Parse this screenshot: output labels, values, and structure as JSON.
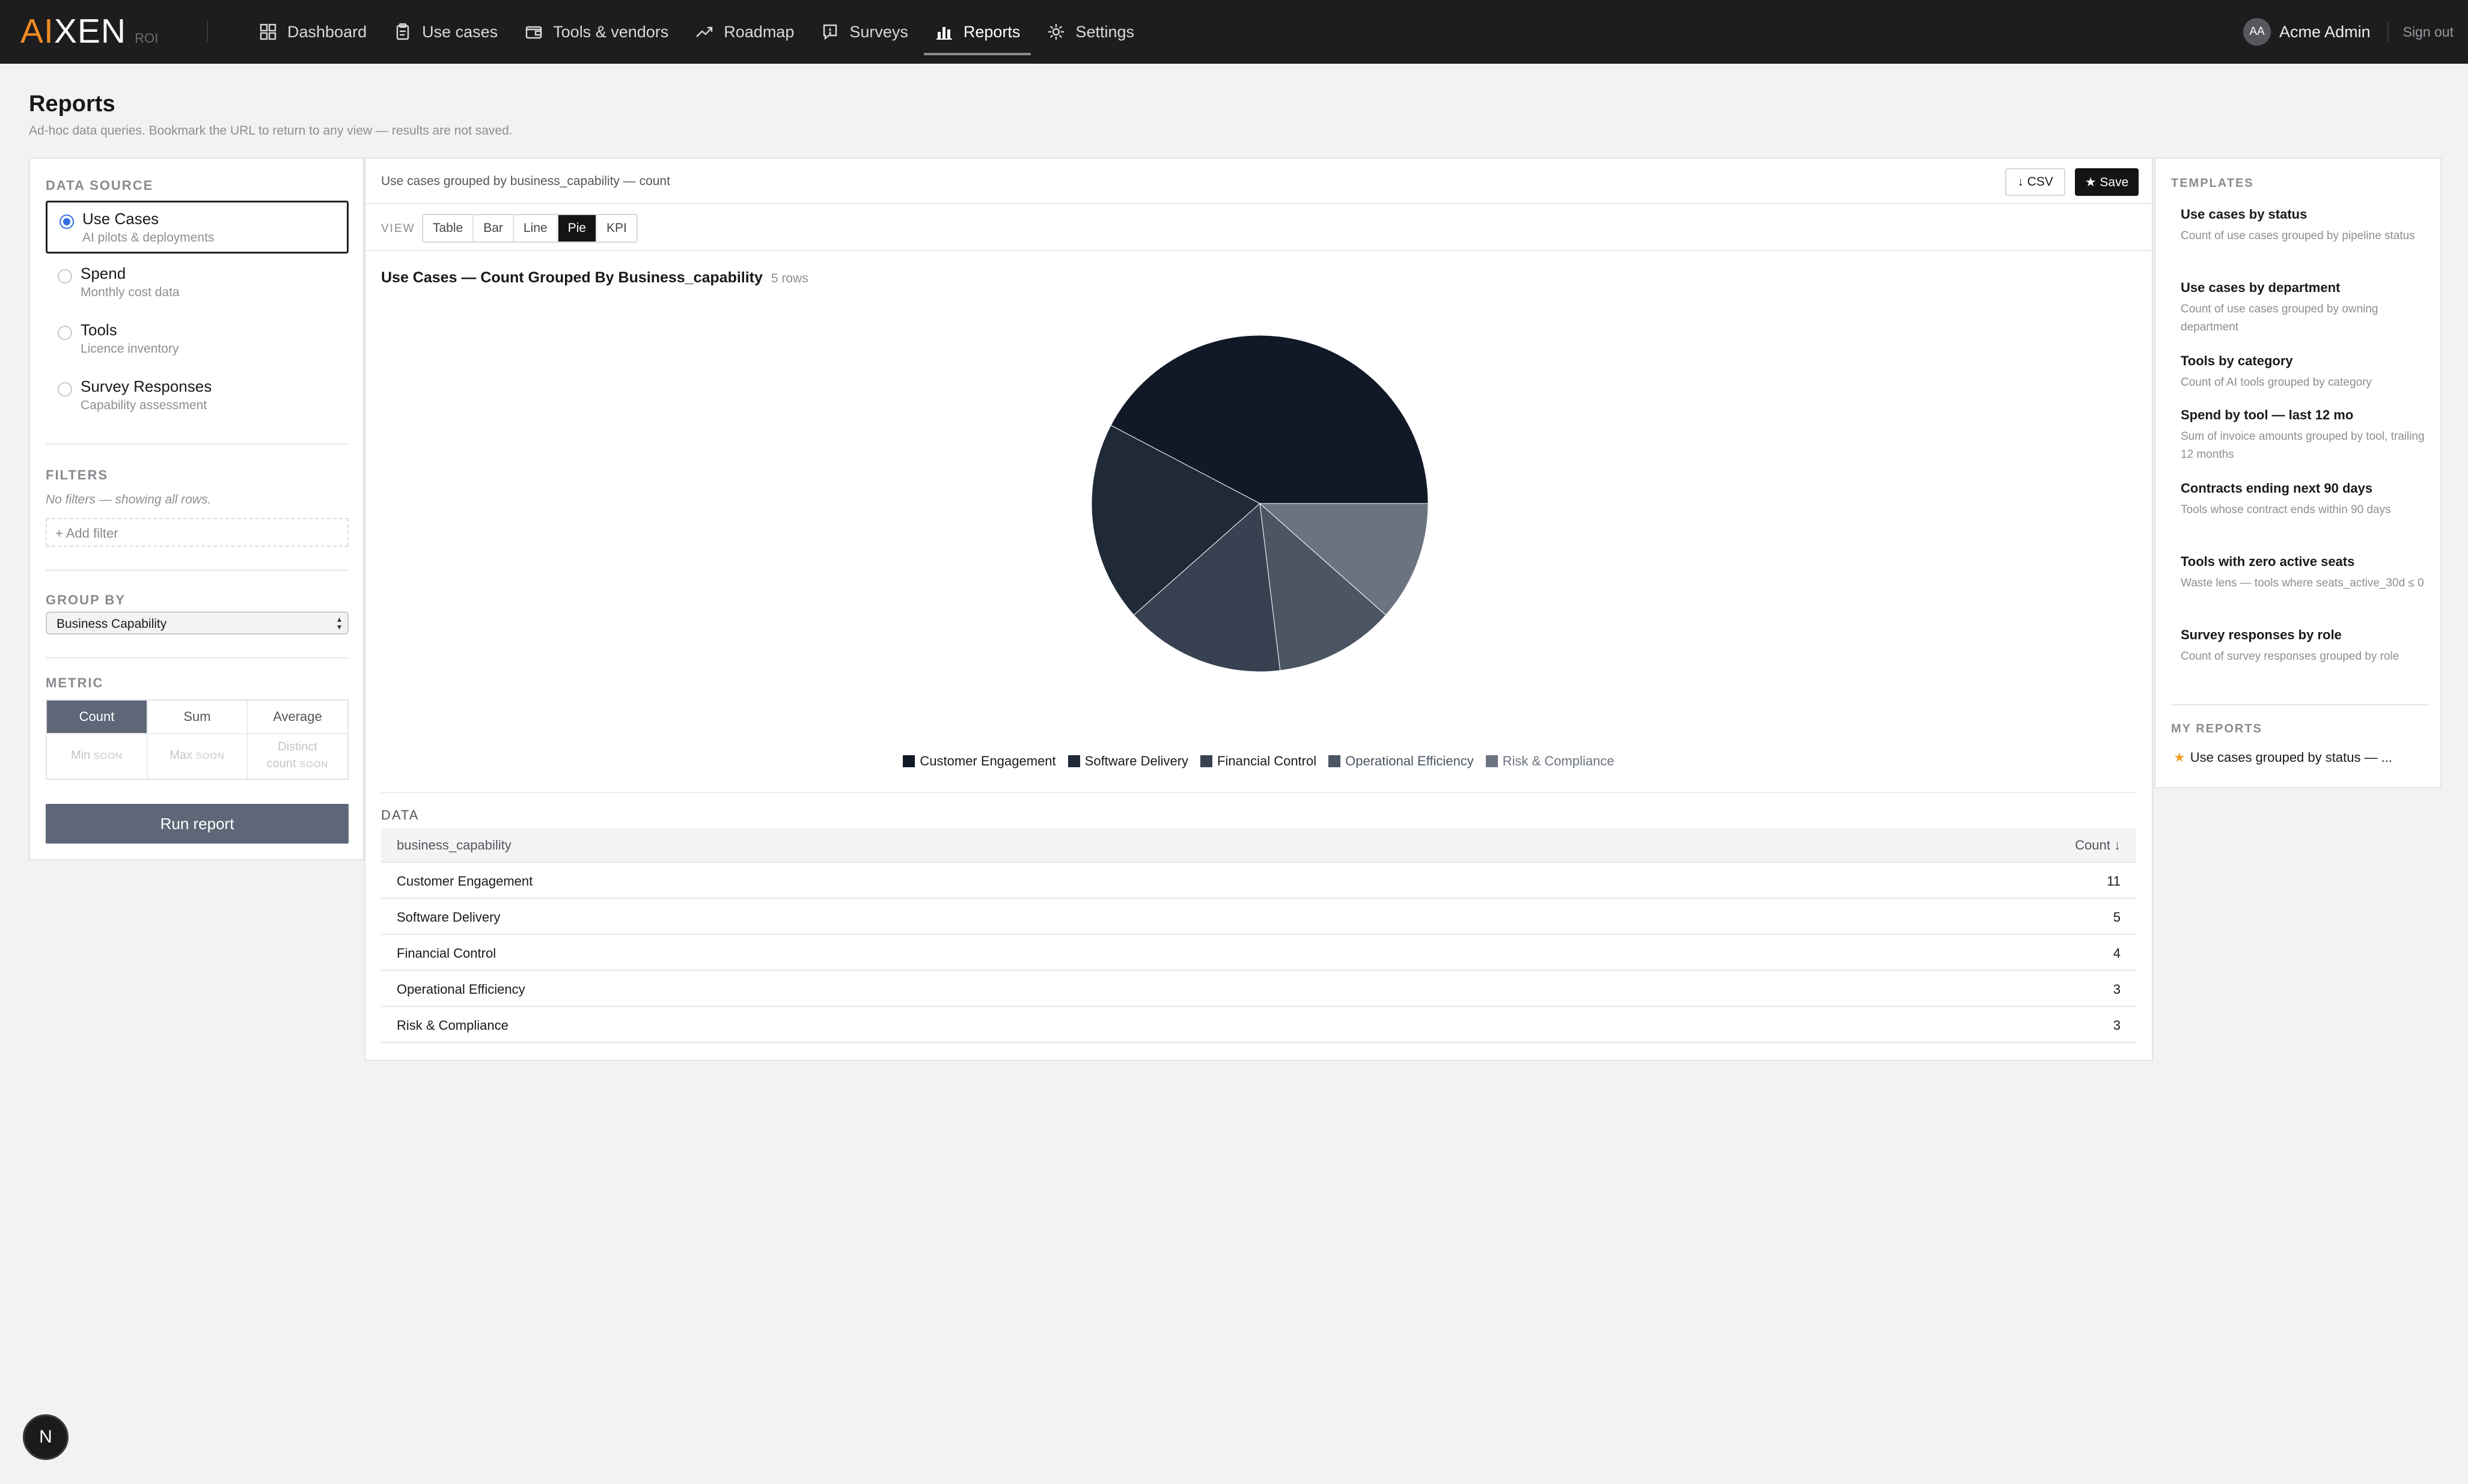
{
  "app": {
    "logo_accent": "AI",
    "logo_rest": "XEN",
    "logo_tag": "ROI",
    "brand_color": "#f08a24"
  },
  "nav": {
    "items": [
      {
        "label": "Dashboard",
        "icon": "grid-icon"
      },
      {
        "label": "Use cases",
        "icon": "clipboard-icon"
      },
      {
        "label": "Tools & vendors",
        "icon": "wallet-icon"
      },
      {
        "label": "Roadmap",
        "icon": "trend-icon"
      },
      {
        "label": "Surveys",
        "icon": "survey-icon"
      },
      {
        "label": "Reports",
        "icon": "bar-chart-icon",
        "active": true
      },
      {
        "label": "Settings",
        "icon": "gear-icon"
      }
    ],
    "user_initials": "AA",
    "user_name": "Acme Admin",
    "sign_out": "Sign out"
  },
  "page": {
    "title": "Reports",
    "subtitle": "Ad-hoc data queries. Bookmark the URL to return to any view — results are not saved."
  },
  "left": {
    "data_source_label": "DATA SOURCE",
    "sources": [
      {
        "title": "Use Cases",
        "desc": "AI pilots & deployments",
        "selected": true
      },
      {
        "title": "Spend",
        "desc": "Monthly cost data",
        "selected": false
      },
      {
        "title": "Tools",
        "desc": "Licence inventory",
        "selected": false
      },
      {
        "title": "Survey Responses",
        "desc": "Capability assessment",
        "selected": false
      }
    ],
    "filters_label": "FILTERS",
    "filters_empty": "No filters — showing all rows.",
    "add_filter": "+ Add filter",
    "group_by_label": "GROUP BY",
    "group_by_value": "Business Capability",
    "metric_label": "METRIC",
    "metrics": [
      "Count",
      "Sum",
      "Average"
    ],
    "metric_selected": "Count",
    "metrics_soon": [
      {
        "label": "Min",
        "soon": "SOON"
      },
      {
        "label": "Max",
        "soon": "SOON"
      },
      {
        "label": "Distinct count",
        "soon": "SOON"
      }
    ],
    "run_button": "Run report"
  },
  "main": {
    "query_text": "Use cases grouped by business_capability — count",
    "csv_button": "↓ CSV",
    "save_button": "★ Save",
    "view_label": "VIEW",
    "views": [
      "Table",
      "Bar",
      "Line",
      "Pie",
      "KPI"
    ],
    "view_selected": "Pie",
    "chart_title": "Use Cases — Count Grouped By Business_capability",
    "row_count": "5 rows",
    "data_label": "DATA",
    "table_headers": [
      "business_capability",
      "Count ↓"
    ]
  },
  "chart_data": {
    "type": "pie",
    "title": "Use Cases — Count Grouped By Business_capability",
    "categories": [
      "Customer Engagement",
      "Software Delivery",
      "Financial Control",
      "Operational Efficiency",
      "Risk & Compliance"
    ],
    "values": [
      11,
      5,
      4,
      3,
      3
    ],
    "colors": [
      "#111827",
      "#1f2937",
      "#374151",
      "#4b5563",
      "#6b7280"
    ],
    "legend_position": "bottom"
  },
  "templates": {
    "label": "TEMPLATES",
    "items": [
      {
        "title": "Use cases by status",
        "desc": "Count of use cases grouped by pipeline status"
      },
      {
        "title": "Use cases by department",
        "desc": "Count of use cases grouped by owning department"
      },
      {
        "title": "Tools by category",
        "desc": "Count of AI tools grouped by category"
      },
      {
        "title": "Spend by tool — last 12 mo",
        "desc": "Sum of invoice amounts grouped by tool, trailing 12 months"
      },
      {
        "title": "Contracts ending next 90 days",
        "desc": "Tools whose contract ends within 90 days"
      },
      {
        "title": "Tools with zero active seats",
        "desc": "Waste lens — tools where seats_active_30d ≤ 0"
      },
      {
        "title": "Survey responses by role",
        "desc": "Count of survey responses grouped by role"
      }
    ],
    "my_reports_label": "MY REPORTS",
    "my_reports": [
      "Use cases grouped by status — ..."
    ]
  },
  "floating": {
    "badge": "N"
  }
}
